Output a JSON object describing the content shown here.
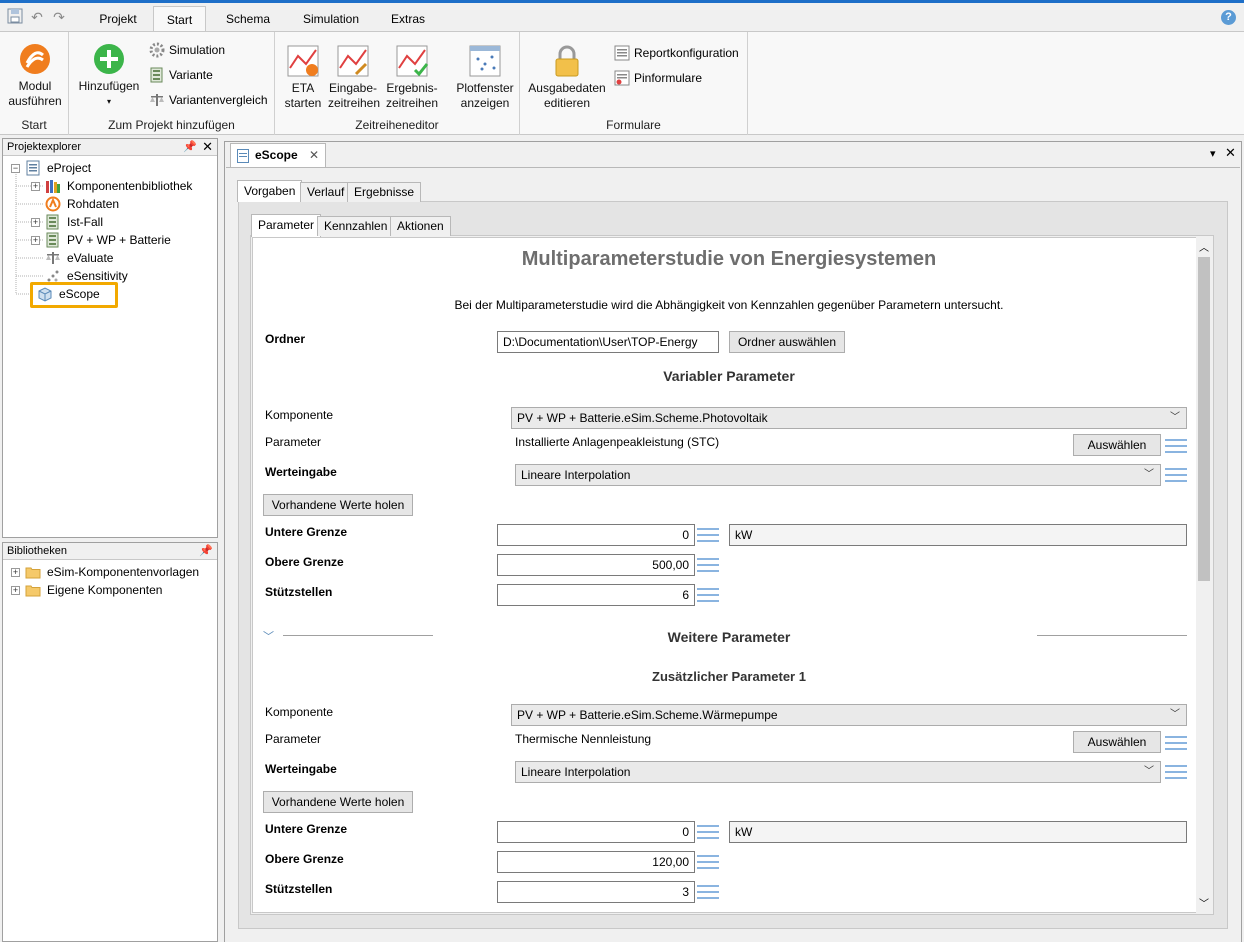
{
  "ribbon": {
    "tabs": [
      "Projekt",
      "Start",
      "Schema",
      "Simulation",
      "Extras"
    ],
    "active_tab": "Start",
    "groups": {
      "start": {
        "label": "Start",
        "modul_line1": "Modul",
        "modul_line2": "ausführen"
      },
      "projekt": {
        "label": "Zum Projekt hinzufügen",
        "hinzufuegen": "Hinzufügen",
        "simulation": "Simulation",
        "variante": "Variante",
        "variantenvergleich": "Variantenvergleich"
      },
      "zeitreihen": {
        "label": "Zeitreiheneditor",
        "eta1": "ETA",
        "eta2": "starten",
        "eingabe1": "Eingabe-",
        "eingabe2": "zeitreihen",
        "ergebnis1": "Ergebnis-",
        "ergebnis2": "zeitreihen",
        "plot1": "Plotfenster",
        "plot2": "anzeigen"
      },
      "formulare": {
        "label": "Formulare",
        "ausgabe1": "Ausgabedaten",
        "ausgabe2": "editieren",
        "report": "Reportkonfiguration",
        "pin": "Pinformulare"
      }
    },
    "accent": "#1e6fc8"
  },
  "projektexplorer": {
    "title": "Projektexplorer",
    "items": [
      {
        "label": "eProject",
        "icon": "project-icon"
      },
      {
        "label": "Komponentenbibliothek",
        "icon": "library-icon"
      },
      {
        "label": "Rohdaten",
        "icon": "rawdata-icon"
      },
      {
        "label": "Ist-Fall",
        "icon": "variant-icon"
      },
      {
        "label": "PV + WP + Batterie",
        "icon": "variant-icon"
      },
      {
        "label": "eValuate",
        "icon": "evaluate-icon"
      },
      {
        "label": "eSensitivity",
        "icon": "sensitivity-icon"
      },
      {
        "label": "eScope",
        "icon": "escope-icon"
      }
    ],
    "selected": "eScope",
    "highlight_color": "#f2a900"
  },
  "bibliotheken": {
    "title": "Bibliotheken",
    "items": [
      {
        "label": "eSim-Komponentenvorlagen",
        "icon": "folder-icon"
      },
      {
        "label": "Eigene Komponenten",
        "icon": "folder-icon"
      }
    ]
  },
  "document": {
    "tab": "eScope",
    "outer_tabs": [
      "Vorgaben",
      "Verlauf",
      "Ergebnisse"
    ],
    "inner_tabs": [
      "Parameter",
      "Kennzahlen",
      "Aktionen"
    ]
  },
  "form": {
    "title": "Multiparameterstudie von Energiesystemen",
    "description": "Bei der Multiparameterstudie wird die Abhängigkeit von Kennzahlen gegenüber Parametern untersucht.",
    "ordner_label": "Ordner",
    "ordner_value": "D:\\Documentation\\User\\TOP-Energy",
    "ordner_button": "Ordner auswählen",
    "variabler": {
      "heading": "Variabler Parameter",
      "komponente_label": "Komponente",
      "komponente_value": "PV + WP + Batterie.eSim.Scheme.Photovoltaik",
      "parameter_label": "Parameter",
      "parameter_value": "Installierte Anlagenpeakleistung (STC)",
      "auswaehlen": "Auswählen",
      "werteingabe_label": "Werteingabe",
      "werteingabe_value": "Lineare Interpolation",
      "holen": "Vorhandene Werte holen",
      "untere_label": "Untere Grenze",
      "untere_value": "0",
      "unit": "kW",
      "obere_label": "Obere Grenze",
      "obere_value": "500,00",
      "stuetz_label": "Stützstellen",
      "stuetz_value": "6"
    },
    "weitere_heading": "Weitere Parameter",
    "zusaetzlich": {
      "heading": "Zusätzlicher Parameter 1",
      "komponente_label": "Komponente",
      "komponente_value": "PV + WP + Batterie.eSim.Scheme.Wärmepumpe",
      "parameter_label": "Parameter",
      "parameter_value": "Thermische Nennleistung",
      "auswaehlen": "Auswählen",
      "werteingabe_label": "Werteingabe",
      "werteingabe_value": "Lineare Interpolation",
      "holen": "Vorhandene Werte holen",
      "untere_label": "Untere Grenze",
      "untere_value": "0",
      "unit": "kW",
      "obere_label": "Obere Grenze",
      "obere_value": "120,00",
      "stuetz_label": "Stützstellen",
      "stuetz_value": "3"
    }
  }
}
